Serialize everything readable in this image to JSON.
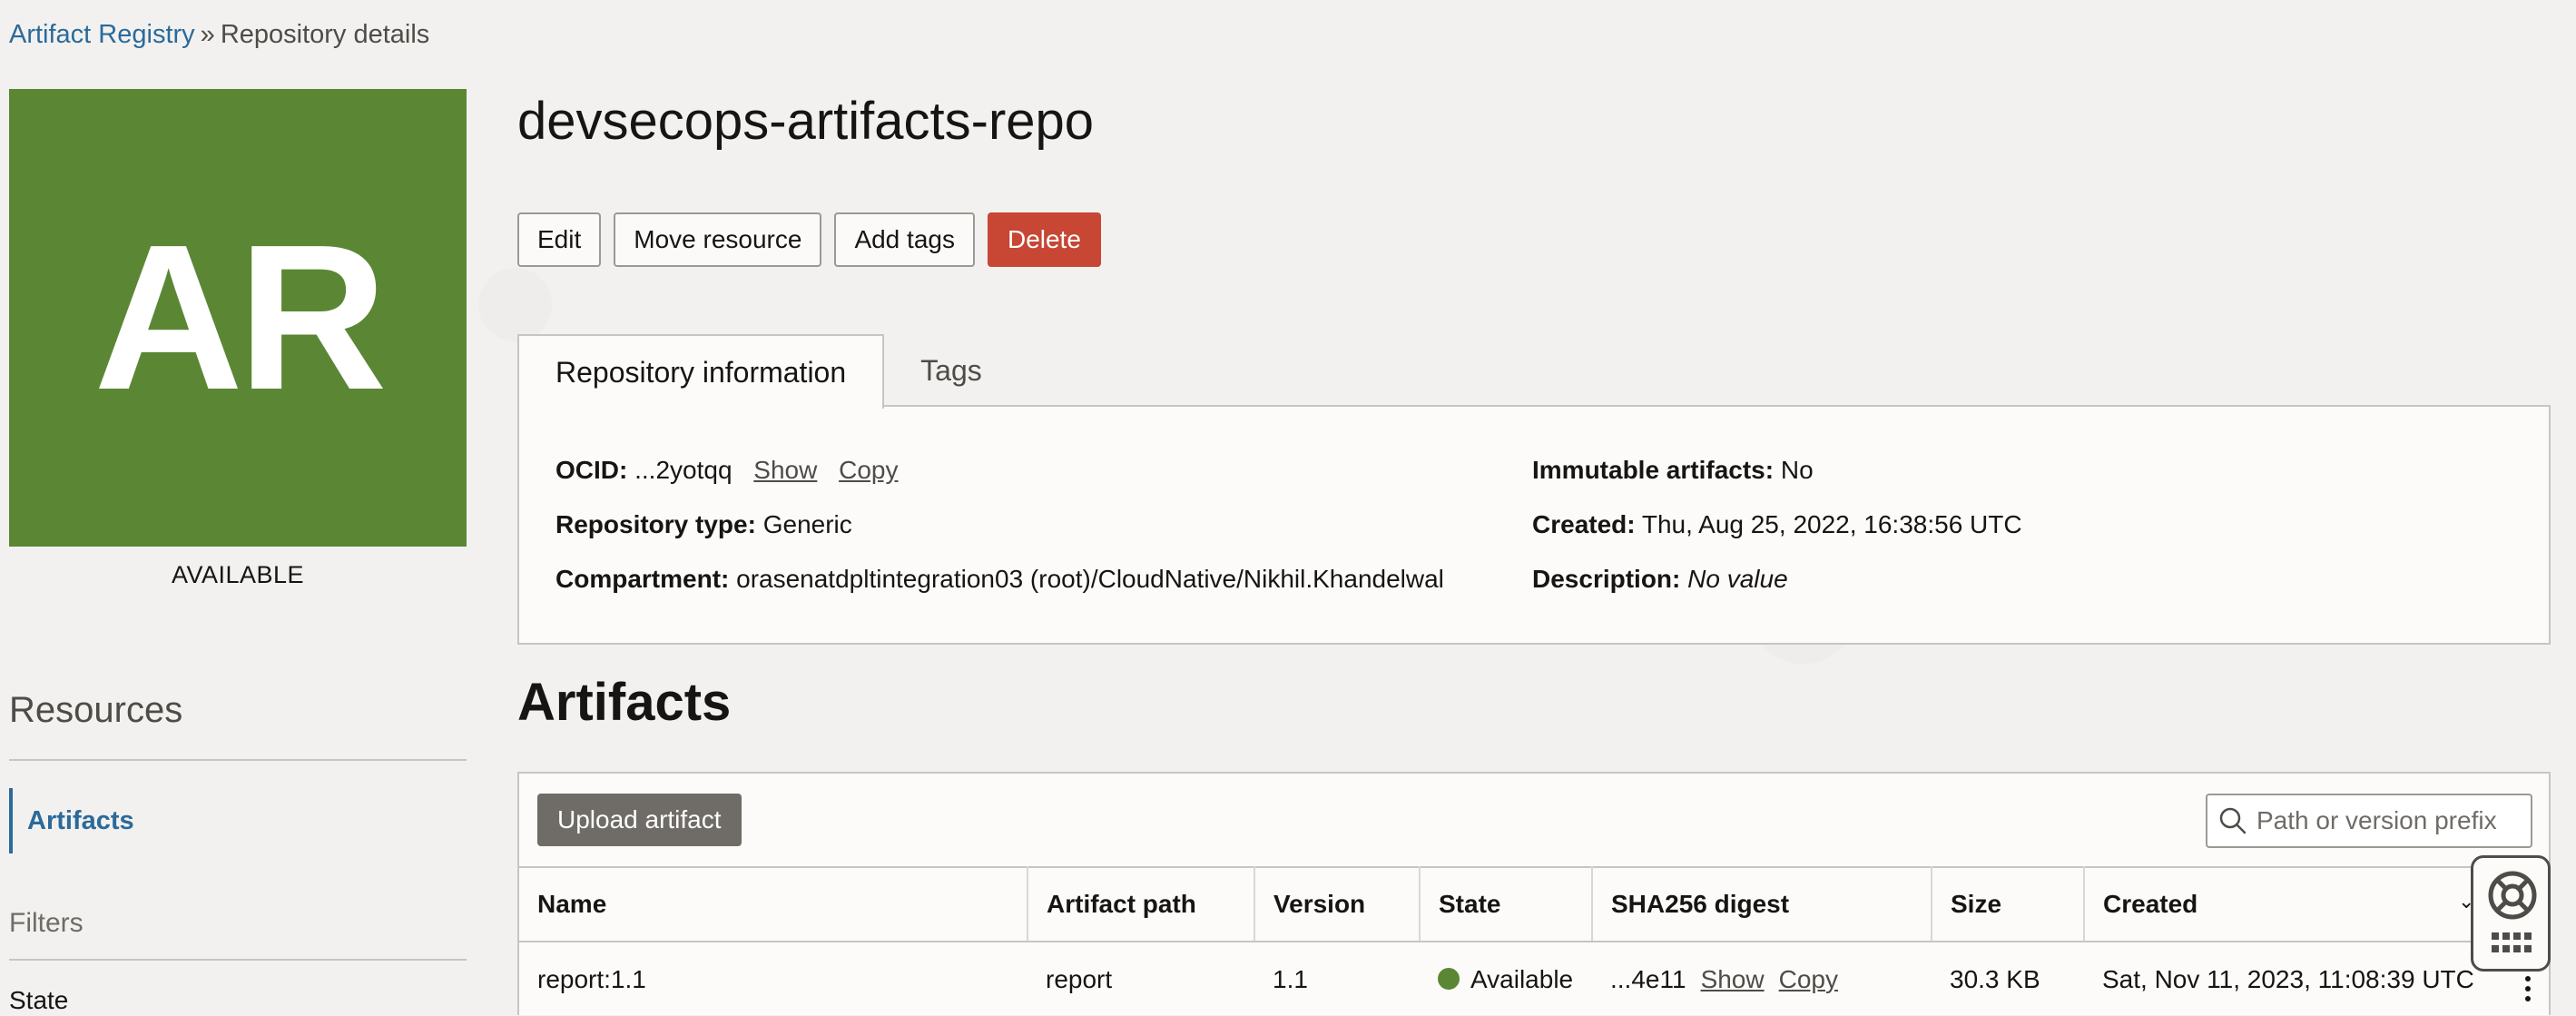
{
  "breadcrumb": {
    "parent": "Artifact Registry",
    "separator": "»",
    "current": "Repository details"
  },
  "avatar": {
    "initials": "AR",
    "status": "AVAILABLE",
    "color": "#5b8735"
  },
  "resources": {
    "heading": "Resources",
    "items": [
      {
        "label": "Artifacts"
      }
    ]
  },
  "filters": {
    "heading": "Filters",
    "state_label": "State"
  },
  "page": {
    "title": "devsecops-artifacts-repo"
  },
  "actions": {
    "edit": "Edit",
    "move": "Move resource",
    "add_tags": "Add tags",
    "delete": "Delete"
  },
  "tabs": [
    {
      "label": "Repository information"
    },
    {
      "label": "Tags"
    }
  ],
  "info": {
    "ocid_label": "OCID:",
    "ocid_value": "...2yotqq",
    "show": "Show",
    "copy": "Copy",
    "repo_type_label": "Repository type:",
    "repo_type_value": "Generic",
    "compartment_label": "Compartment:",
    "compartment_value": "orasenatdpltintegration03 (root)/CloudNative/Nikhil.Khandelwal",
    "immutable_label": "Immutable artifacts:",
    "immutable_value": "No",
    "created_label": "Created:",
    "created_value": "Thu, Aug 25, 2022, 16:38:56 UTC",
    "description_label": "Description:",
    "description_value": "No value"
  },
  "artifacts": {
    "title": "Artifacts",
    "upload_label": "Upload artifact",
    "search_placeholder": "Path or version prefix",
    "columns": [
      "Name",
      "Artifact path",
      "Version",
      "State",
      "SHA256 digest",
      "Size",
      "Created"
    ],
    "rows": [
      {
        "name": "report:1.1",
        "path": "report",
        "version": "1.1",
        "state": "Available",
        "digest": "...4e11",
        "show": "Show",
        "copy": "Copy",
        "size": "30.3 KB",
        "created": "Sat, Nov 11, 2023, 11:08:39 UTC"
      }
    ]
  },
  "colors": {
    "link": "#2b6a9a",
    "danger": "#c74634",
    "available": "#5b8735"
  }
}
